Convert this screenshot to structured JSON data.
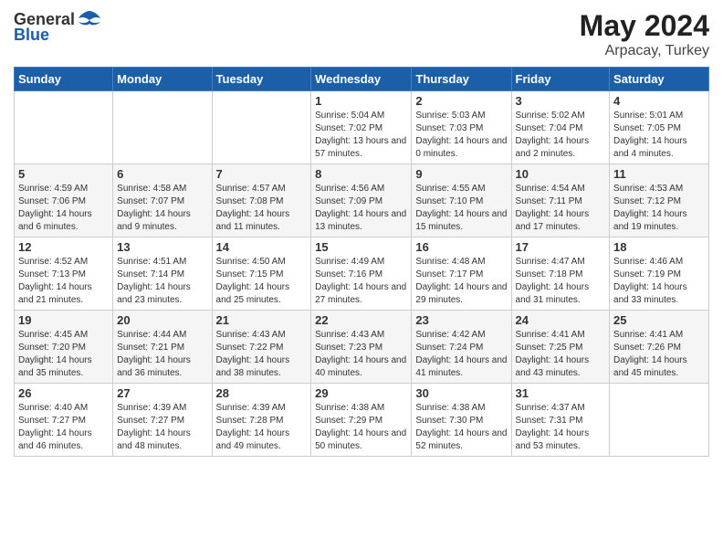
{
  "header": {
    "logo_general": "General",
    "logo_blue": "Blue",
    "main_title": "May 2024",
    "subtitle": "Arpacay, Turkey"
  },
  "days_of_week": [
    "Sunday",
    "Monday",
    "Tuesday",
    "Wednesday",
    "Thursday",
    "Friday",
    "Saturday"
  ],
  "weeks": [
    [
      {
        "num": "",
        "sunrise": "",
        "sunset": "",
        "daylight": ""
      },
      {
        "num": "",
        "sunrise": "",
        "sunset": "",
        "daylight": ""
      },
      {
        "num": "",
        "sunrise": "",
        "sunset": "",
        "daylight": ""
      },
      {
        "num": "1",
        "sunrise": "Sunrise: 5:04 AM",
        "sunset": "Sunset: 7:02 PM",
        "daylight": "Daylight: 13 hours and 57 minutes."
      },
      {
        "num": "2",
        "sunrise": "Sunrise: 5:03 AM",
        "sunset": "Sunset: 7:03 PM",
        "daylight": "Daylight: 14 hours and 0 minutes."
      },
      {
        "num": "3",
        "sunrise": "Sunrise: 5:02 AM",
        "sunset": "Sunset: 7:04 PM",
        "daylight": "Daylight: 14 hours and 2 minutes."
      },
      {
        "num": "4",
        "sunrise": "Sunrise: 5:01 AM",
        "sunset": "Sunset: 7:05 PM",
        "daylight": "Daylight: 14 hours and 4 minutes."
      }
    ],
    [
      {
        "num": "5",
        "sunrise": "Sunrise: 4:59 AM",
        "sunset": "Sunset: 7:06 PM",
        "daylight": "Daylight: 14 hours and 6 minutes."
      },
      {
        "num": "6",
        "sunrise": "Sunrise: 4:58 AM",
        "sunset": "Sunset: 7:07 PM",
        "daylight": "Daylight: 14 hours and 9 minutes."
      },
      {
        "num": "7",
        "sunrise": "Sunrise: 4:57 AM",
        "sunset": "Sunset: 7:08 PM",
        "daylight": "Daylight: 14 hours and 11 minutes."
      },
      {
        "num": "8",
        "sunrise": "Sunrise: 4:56 AM",
        "sunset": "Sunset: 7:09 PM",
        "daylight": "Daylight: 14 hours and 13 minutes."
      },
      {
        "num": "9",
        "sunrise": "Sunrise: 4:55 AM",
        "sunset": "Sunset: 7:10 PM",
        "daylight": "Daylight: 14 hours and 15 minutes."
      },
      {
        "num": "10",
        "sunrise": "Sunrise: 4:54 AM",
        "sunset": "Sunset: 7:11 PM",
        "daylight": "Daylight: 14 hours and 17 minutes."
      },
      {
        "num": "11",
        "sunrise": "Sunrise: 4:53 AM",
        "sunset": "Sunset: 7:12 PM",
        "daylight": "Daylight: 14 hours and 19 minutes."
      }
    ],
    [
      {
        "num": "12",
        "sunrise": "Sunrise: 4:52 AM",
        "sunset": "Sunset: 7:13 PM",
        "daylight": "Daylight: 14 hours and 21 minutes."
      },
      {
        "num": "13",
        "sunrise": "Sunrise: 4:51 AM",
        "sunset": "Sunset: 7:14 PM",
        "daylight": "Daylight: 14 hours and 23 minutes."
      },
      {
        "num": "14",
        "sunrise": "Sunrise: 4:50 AM",
        "sunset": "Sunset: 7:15 PM",
        "daylight": "Daylight: 14 hours and 25 minutes."
      },
      {
        "num": "15",
        "sunrise": "Sunrise: 4:49 AM",
        "sunset": "Sunset: 7:16 PM",
        "daylight": "Daylight: 14 hours and 27 minutes."
      },
      {
        "num": "16",
        "sunrise": "Sunrise: 4:48 AM",
        "sunset": "Sunset: 7:17 PM",
        "daylight": "Daylight: 14 hours and 29 minutes."
      },
      {
        "num": "17",
        "sunrise": "Sunrise: 4:47 AM",
        "sunset": "Sunset: 7:18 PM",
        "daylight": "Daylight: 14 hours and 31 minutes."
      },
      {
        "num": "18",
        "sunrise": "Sunrise: 4:46 AM",
        "sunset": "Sunset: 7:19 PM",
        "daylight": "Daylight: 14 hours and 33 minutes."
      }
    ],
    [
      {
        "num": "19",
        "sunrise": "Sunrise: 4:45 AM",
        "sunset": "Sunset: 7:20 PM",
        "daylight": "Daylight: 14 hours and 35 minutes."
      },
      {
        "num": "20",
        "sunrise": "Sunrise: 4:44 AM",
        "sunset": "Sunset: 7:21 PM",
        "daylight": "Daylight: 14 hours and 36 minutes."
      },
      {
        "num": "21",
        "sunrise": "Sunrise: 4:43 AM",
        "sunset": "Sunset: 7:22 PM",
        "daylight": "Daylight: 14 hours and 38 minutes."
      },
      {
        "num": "22",
        "sunrise": "Sunrise: 4:43 AM",
        "sunset": "Sunset: 7:23 PM",
        "daylight": "Daylight: 14 hours and 40 minutes."
      },
      {
        "num": "23",
        "sunrise": "Sunrise: 4:42 AM",
        "sunset": "Sunset: 7:24 PM",
        "daylight": "Daylight: 14 hours and 41 minutes."
      },
      {
        "num": "24",
        "sunrise": "Sunrise: 4:41 AM",
        "sunset": "Sunset: 7:25 PM",
        "daylight": "Daylight: 14 hours and 43 minutes."
      },
      {
        "num": "25",
        "sunrise": "Sunrise: 4:41 AM",
        "sunset": "Sunset: 7:26 PM",
        "daylight": "Daylight: 14 hours and 45 minutes."
      }
    ],
    [
      {
        "num": "26",
        "sunrise": "Sunrise: 4:40 AM",
        "sunset": "Sunset: 7:27 PM",
        "daylight": "Daylight: 14 hours and 46 minutes."
      },
      {
        "num": "27",
        "sunrise": "Sunrise: 4:39 AM",
        "sunset": "Sunset: 7:27 PM",
        "daylight": "Daylight: 14 hours and 48 minutes."
      },
      {
        "num": "28",
        "sunrise": "Sunrise: 4:39 AM",
        "sunset": "Sunset: 7:28 PM",
        "daylight": "Daylight: 14 hours and 49 minutes."
      },
      {
        "num": "29",
        "sunrise": "Sunrise: 4:38 AM",
        "sunset": "Sunset: 7:29 PM",
        "daylight": "Daylight: 14 hours and 50 minutes."
      },
      {
        "num": "30",
        "sunrise": "Sunrise: 4:38 AM",
        "sunset": "Sunset: 7:30 PM",
        "daylight": "Daylight: 14 hours and 52 minutes."
      },
      {
        "num": "31",
        "sunrise": "Sunrise: 4:37 AM",
        "sunset": "Sunset: 7:31 PM",
        "daylight": "Daylight: 14 hours and 53 minutes."
      },
      {
        "num": "",
        "sunrise": "",
        "sunset": "",
        "daylight": ""
      }
    ]
  ]
}
